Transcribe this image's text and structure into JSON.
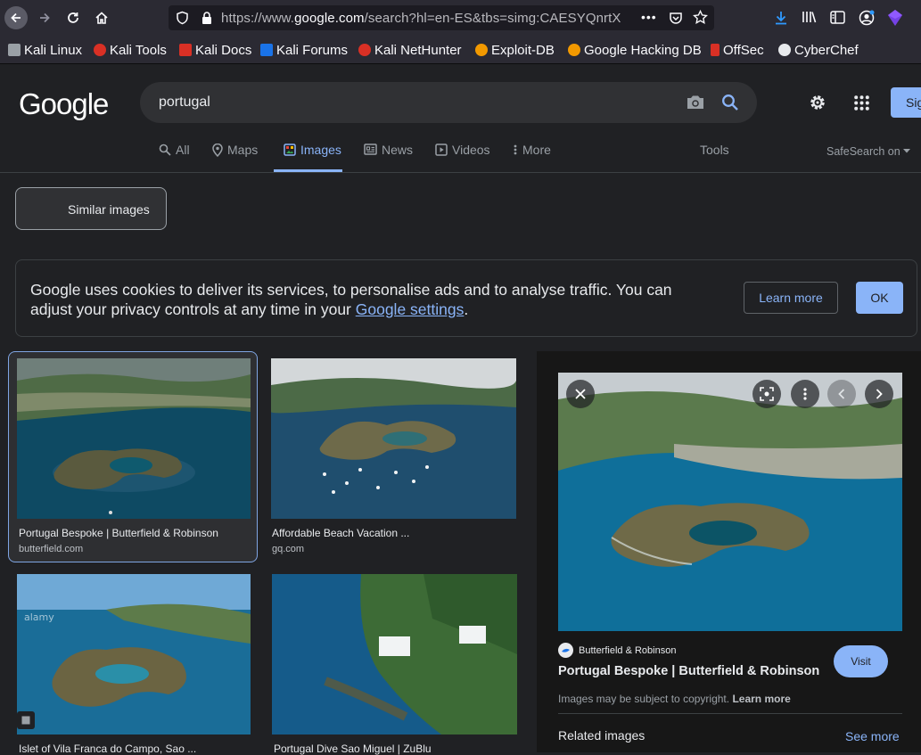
{
  "browser": {
    "url_prefix": "https://www.",
    "url_domain": "google.com",
    "url_rest": "/search?hl=en-ES&tbs=simg:CAESYQnrtX",
    "bookmarks": [
      {
        "label": "Kali Linux",
        "color": "#9aa0a6"
      },
      {
        "label": "Kali Tools",
        "color": "#d93025"
      },
      {
        "label": "Kali Docs",
        "color": "#d93025"
      },
      {
        "label": "Kali Forums",
        "color": "#1a73e8"
      },
      {
        "label": "Kali NetHunter",
        "color": "#d93025"
      },
      {
        "label": "Exploit-DB",
        "color": "#f29900"
      },
      {
        "label": "Google Hacking DB",
        "color": "#f29900"
      },
      {
        "label": "OffSec",
        "color": "#d93025"
      },
      {
        "label": "CyberChef",
        "color": "#e8eaed"
      }
    ]
  },
  "google": {
    "logo": "Google",
    "query": "portugal",
    "signin": "Sign in",
    "tabs": [
      {
        "label": "All",
        "icon": "search-icon",
        "active": false
      },
      {
        "label": "Maps",
        "icon": "pin-icon",
        "active": false
      },
      {
        "label": "Images",
        "icon": "image-icon",
        "active": true
      },
      {
        "label": "News",
        "icon": "news-icon",
        "active": false
      },
      {
        "label": "Videos",
        "icon": "video-icon",
        "active": false
      },
      {
        "label": "More",
        "icon": "more-vertical-icon",
        "active": false
      }
    ],
    "tools": "Tools",
    "safesearch": "SafeSearch on",
    "similar_images": "Similar images"
  },
  "cookie": {
    "text_before": "Google uses cookies to deliver its services, to personalise ads and to analyse traffic. You can adjust your privacy controls at any time in your ",
    "link": "Google settings",
    "text_after": ".",
    "learn_more": "Learn more",
    "ok": "OK"
  },
  "results": [
    {
      "title": "Portugal Bespoke | Butterfield & Robinson",
      "domain": "butterfield.com"
    },
    {
      "title": "Affordable Beach Vacation ...",
      "domain": "gq.com"
    },
    {
      "title": "Islet of Vila Franca do Campo, Sao ...",
      "domain": ""
    },
    {
      "title": "Portugal Dive Sao Miguel | ZuBlu",
      "domain": ""
    }
  ],
  "preview": {
    "source": "Butterfield & Robinson",
    "title": "Portugal Bespoke | Butterfield & Robinson",
    "visit": "Visit",
    "copyright": "Images may be subject to copyright.",
    "copyright_link": "Learn more",
    "related": "Related images",
    "see_more": "See more"
  }
}
